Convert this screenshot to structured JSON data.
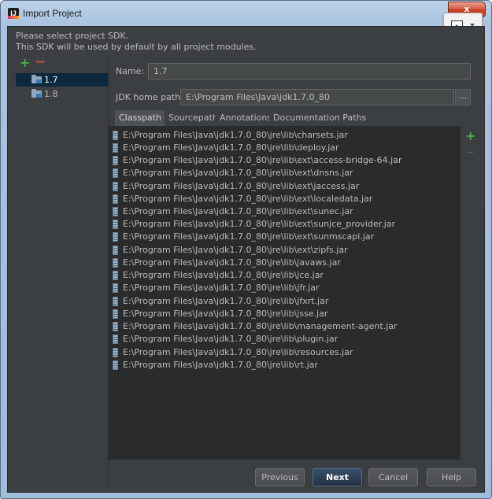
{
  "window": {
    "title": "Import Project",
    "close_glyph": "x"
  },
  "header": {
    "line1": "Please select project SDK.",
    "line2": "This SDK will be used by default by all project modules."
  },
  "sdk_list": {
    "add_glyph": "+",
    "remove_glyph": "−",
    "items": [
      {
        "label": "1.7",
        "selected": true
      },
      {
        "label": "1.8",
        "selected": false
      }
    ]
  },
  "form": {
    "name_label": "Name:",
    "name_value": "1.7",
    "jdk_home_label": "JDK home path:",
    "jdk_home_value": "E:\\Program Files\\Java\\jdk1.7.0_80",
    "browse_label": "..."
  },
  "tabs": [
    {
      "label": "Classpath",
      "active": true
    },
    {
      "label": "Sourcepath",
      "active": false
    },
    {
      "label": "Annotations",
      "active": false
    },
    {
      "label": "Documentation Paths",
      "active": false
    }
  ],
  "classpath": [
    "E:\\Program Files\\Java\\jdk1.7.0_80\\jre\\lib\\charsets.jar",
    "E:\\Program Files\\Java\\jdk1.7.0_80\\jre\\lib\\deploy.jar",
    "E:\\Program Files\\Java\\jdk1.7.0_80\\jre\\lib\\ext\\access-bridge-64.jar",
    "E:\\Program Files\\Java\\jdk1.7.0_80\\jre\\lib\\ext\\dnsns.jar",
    "E:\\Program Files\\Java\\jdk1.7.0_80\\jre\\lib\\ext\\jaccess.jar",
    "E:\\Program Files\\Java\\jdk1.7.0_80\\jre\\lib\\ext\\localedata.jar",
    "E:\\Program Files\\Java\\jdk1.7.0_80\\jre\\lib\\ext\\sunec.jar",
    "E:\\Program Files\\Java\\jdk1.7.0_80\\jre\\lib\\ext\\sunjce_provider.jar",
    "E:\\Program Files\\Java\\jdk1.7.0_80\\jre\\lib\\ext\\sunmscapi.jar",
    "E:\\Program Files\\Java\\jdk1.7.0_80\\jre\\lib\\ext\\zipfs.jar",
    "E:\\Program Files\\Java\\jdk1.7.0_80\\jre\\lib\\javaws.jar",
    "E:\\Program Files\\Java\\jdk1.7.0_80\\jre\\lib\\jce.jar",
    "E:\\Program Files\\Java\\jdk1.7.0_80\\jre\\lib\\jfr.jar",
    "E:\\Program Files\\Java\\jdk1.7.0_80\\jre\\lib\\jfxrt.jar",
    "E:\\Program Files\\Java\\jdk1.7.0_80\\jre\\lib\\jsse.jar",
    "E:\\Program Files\\Java\\jdk1.7.0_80\\jre\\lib\\management-agent.jar",
    "E:\\Program Files\\Java\\jdk1.7.0_80\\jre\\lib\\plugin.jar",
    "E:\\Program Files\\Java\\jdk1.7.0_80\\jre\\lib\\resources.jar",
    "E:\\Program Files\\Java\\jdk1.7.0_80\\jre\\lib\\rt.jar"
  ],
  "classpath_toolbar": {
    "add_glyph": "+",
    "remove_glyph": "−"
  },
  "buttons": {
    "previous": "Previous",
    "next": "Next",
    "cancel": "Cancel",
    "help": "Help"
  },
  "colors": {
    "dialog_background": "#3c3f41",
    "list_background": "#2b2b2b",
    "selection": "#0d293e",
    "add_green": "#4cae4c",
    "remove_red": "#d14b4b"
  },
  "icons": {
    "app": "intellij-idea-icon",
    "sdk": "jdk-folder-icon",
    "classpath_entry": "jar-icon",
    "toolbar_image": "image-icon"
  }
}
